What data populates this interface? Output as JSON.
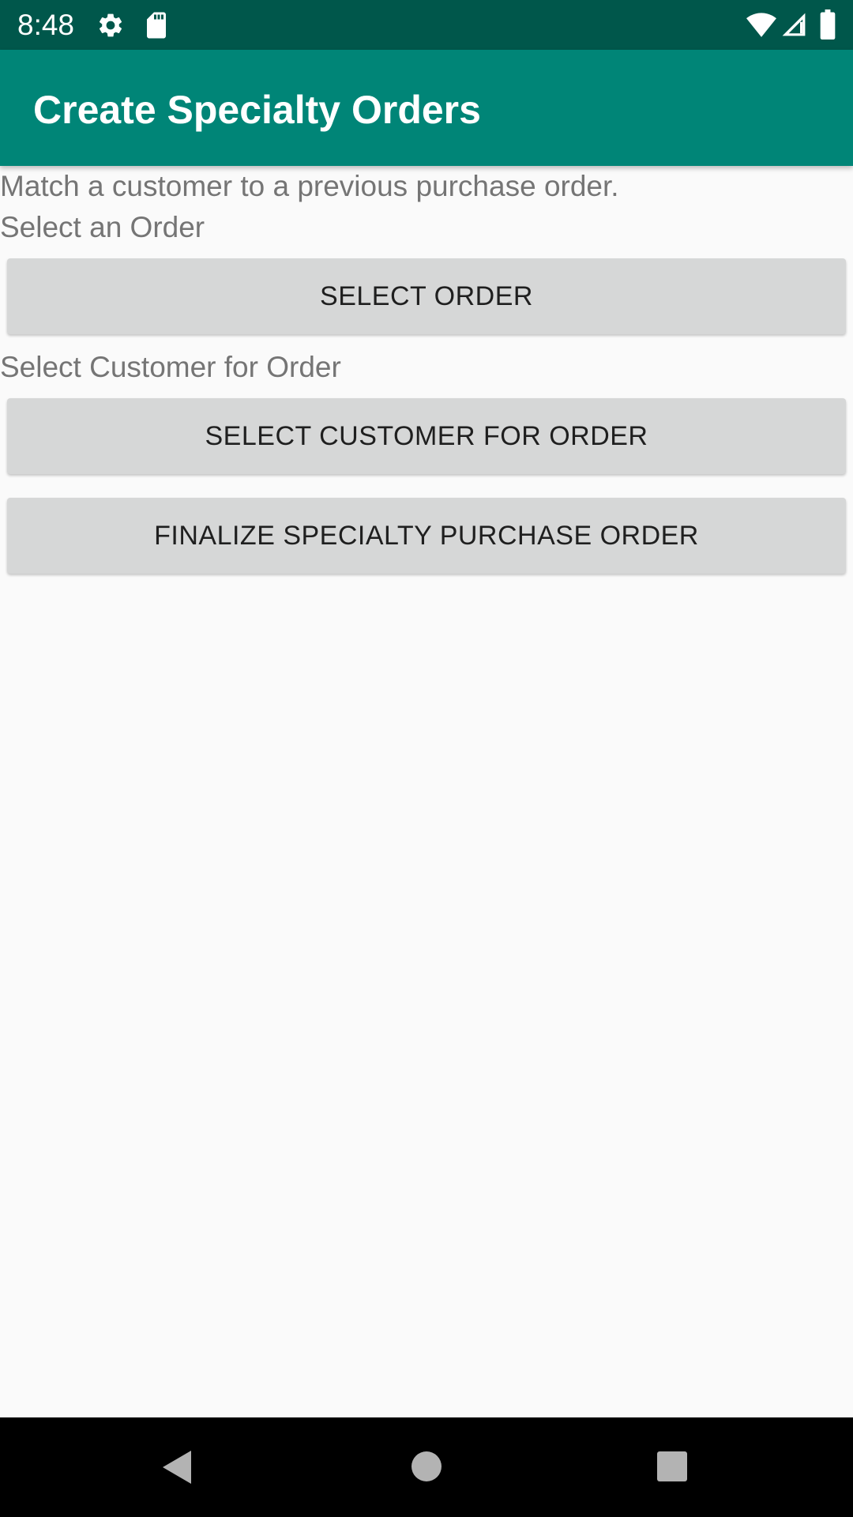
{
  "status_bar": {
    "time": "8:48",
    "icons": [
      "gear-icon",
      "sd-card-icon",
      "wifi-icon",
      "signal-icon",
      "battery-icon"
    ]
  },
  "app_bar": {
    "title": "Create Specialty Orders",
    "color": "#008577"
  },
  "main": {
    "description": "Match a customer to a previous purchase order.",
    "select_order_label": "Select an Order",
    "select_order_button": "SELECT ORDER",
    "select_customer_label": "Select Customer for Order",
    "select_customer_button": "SELECT CUSTOMER FOR ORDER",
    "finalize_button": "FINALIZE SPECIALTY PURCHASE ORDER"
  },
  "nav_bar": {
    "icons": [
      "back-icon",
      "home-icon",
      "recents-icon"
    ]
  },
  "colors": {
    "status_bar": "#00574b",
    "app_bar": "#008577",
    "background": "#fafafa",
    "button": "#d6d7d7"
  }
}
